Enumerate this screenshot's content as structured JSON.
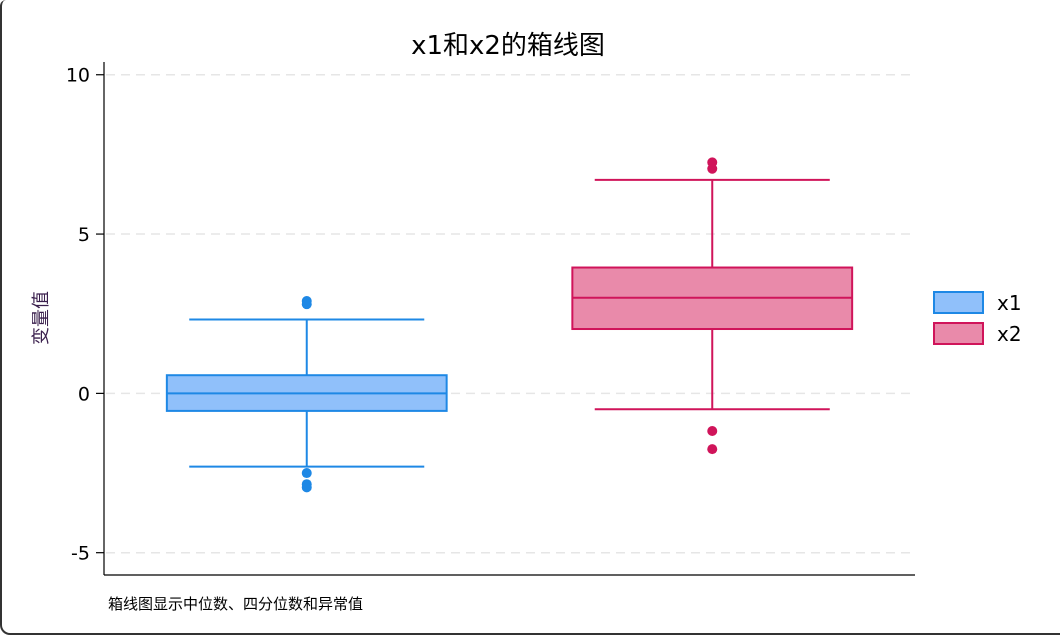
{
  "chart_data": {
    "type": "box",
    "title": "x1和x2的箱线图",
    "xlabel": "",
    "ylabel": "变量值",
    "ylim": [
      -5.7,
      10.4
    ],
    "yticks": [
      -5,
      0,
      5,
      10
    ],
    "grid": true,
    "legend_position": "right",
    "note": "箱线图显示中位数、四分位数和异常值",
    "series": [
      {
        "name": "x1",
        "fill": "#90c0fa",
        "stroke": "#1e88e5",
        "whisker_low": -2.3,
        "q1": -0.55,
        "median": 0.0,
        "q3": 0.57,
        "whisker_high": 2.32,
        "outliers": [
          2.9,
          2.8,
          -2.5,
          -2.85,
          -2.95
        ]
      },
      {
        "name": "x2",
        "fill": "#e98aaa",
        "stroke": "#d0145a",
        "whisker_low": -0.5,
        "q1": 2.02,
        "median": 3.0,
        "q3": 3.95,
        "whisker_high": 6.7,
        "outliers": [
          7.25,
          7.05,
          -1.18,
          -1.75
        ]
      }
    ]
  }
}
